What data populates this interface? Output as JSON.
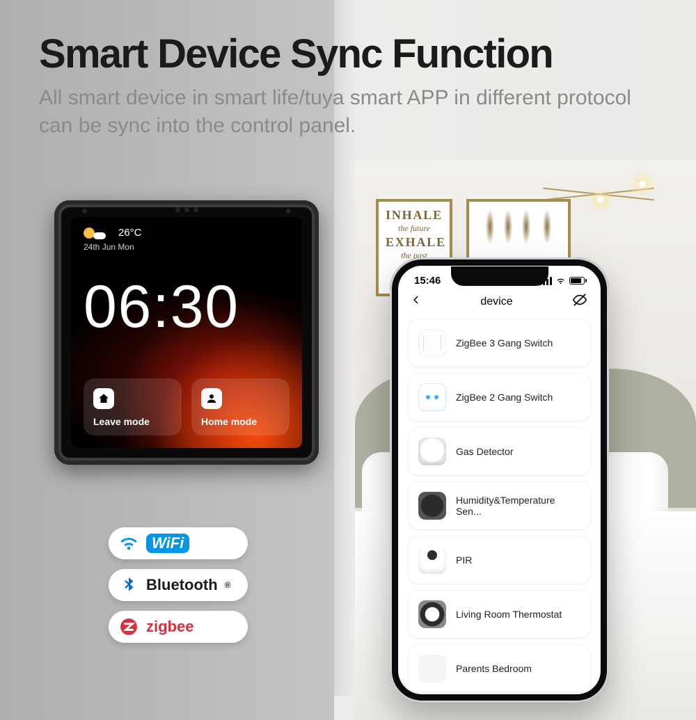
{
  "headline": {
    "title": "Smart Device Sync Function",
    "subtitle": "All smart device in smart life/tuya smart APP in different protocol can be sync into the control panel."
  },
  "room_art": {
    "frame1_line1": "INHALE",
    "frame1_line2": "the future",
    "frame1_line3": "EXHALE",
    "frame1_line4": "the past"
  },
  "panel": {
    "temperature": "26°C",
    "date": "24th Jun  Mon",
    "clock": "06:30",
    "mode_leave": "Leave mode",
    "mode_home": "Home mode"
  },
  "badges": {
    "wifi_label": "WiFi",
    "bluetooth_label": "Bluetooth",
    "zigbee_label": "zigbee"
  },
  "phone": {
    "status_time": "15:46",
    "nav_title": "device",
    "devices": [
      {
        "name": "ZigBee 3 Gang Switch"
      },
      {
        "name": "ZigBee 2 Gang Switch"
      },
      {
        "name": "Gas Detector"
      },
      {
        "name": "Humidity&Temperature Sen..."
      },
      {
        "name": "PIR"
      },
      {
        "name": "Living Room Thermostat"
      },
      {
        "name": "Parents Bedroom"
      }
    ]
  }
}
